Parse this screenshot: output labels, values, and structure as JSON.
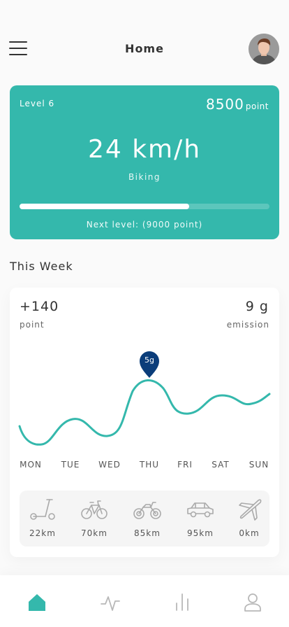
{
  "header": {
    "title": "Home",
    "menu_icon": "hamburger-menu-icon",
    "avatar_icon": "user-avatar"
  },
  "level_card": {
    "level_label": "Level 6",
    "points_value": "8500",
    "points_unit": "point",
    "speed": "24 km/h",
    "activity": "Biking",
    "progress": 0.68,
    "next_level_text": "Next level: (9000 point)",
    "colors": {
      "background": "#34b8ac"
    }
  },
  "week": {
    "section_title": "This Week",
    "points_value": "+140",
    "points_label": "point",
    "emission_value": "9 g",
    "emission_label": "emission",
    "marker_label": "5g",
    "marker_day_index": 3,
    "days": [
      "MON",
      "TUE",
      "WED",
      "THU",
      "FRI",
      "SAT",
      "SUN"
    ],
    "colors": {
      "line": "#34b8ac",
      "marker": "#0b3d7a"
    },
    "modes": [
      {
        "icon": "scooter-icon",
        "label": "22km"
      },
      {
        "icon": "bicycle-icon",
        "label": "70km"
      },
      {
        "icon": "motorcycle-icon",
        "label": "85km"
      },
      {
        "icon": "car-icon",
        "label": "95km"
      },
      {
        "icon": "airplane-icon",
        "label": "0km"
      }
    ]
  },
  "tabbar": {
    "tabs": [
      {
        "icon": "home-icon",
        "active": true
      },
      {
        "icon": "activity-icon",
        "active": false
      },
      {
        "icon": "bar-chart-icon",
        "active": false
      },
      {
        "icon": "profile-icon",
        "active": false
      }
    ],
    "colors": {
      "active": "#34b8ac",
      "inactive": "#b8b8b8"
    }
  }
}
